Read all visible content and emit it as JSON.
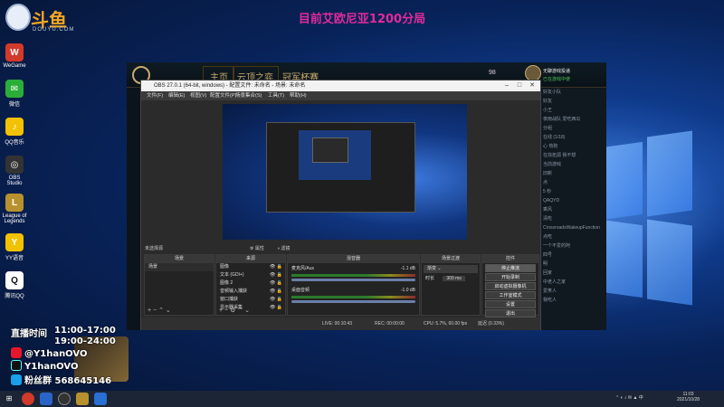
{
  "brand": {
    "name": "斗鱼",
    "domain": "DOUYU.COM"
  },
  "stream_title": "目前艾欧尼亚1200分局",
  "desktop_icons": [
    {
      "label": "WeGame",
      "color": "#d23a2a",
      "glyph": "W"
    },
    {
      "label": "微信",
      "color": "#2aae39",
      "glyph": "✉"
    },
    {
      "label": "QQ音乐",
      "color": "#f2c200",
      "glyph": "♪"
    },
    {
      "label": "OBS Studio",
      "color": "#333333",
      "glyph": "◎"
    },
    {
      "label": "League of Legends",
      "color": "#b8912f",
      "glyph": "L"
    },
    {
      "label": "YY语音",
      "color": "#f2c200",
      "glyph": "Y"
    },
    {
      "label": "腾讯QQ",
      "color": "#ffffff",
      "glyph": "Q"
    }
  ],
  "lol_client": {
    "nav": [
      "主页",
      "云顶之弈",
      "冠军杯赛"
    ],
    "currency": "98",
    "status": "无聊游戏投递",
    "status_sub": "已在游戏中使",
    "right_rows": [
      "好友小队",
      "好友",
      "小王",
      "夜雨战队 爱吃西瓜",
      "分组",
      "在线 (1/18)",
      "心 热狗",
      "在找拓源 我不想",
      "当前游戏",
      "旧新",
      "点",
      "5 秒",
      "QAQYD",
      "乘风",
      "清吃",
      "CrossroadsWakeupFunction",
      "点吃",
      "一个不爱的阿",
      "四号",
      "明",
      "回家",
      "中老人之家",
      "爱笑人",
      "我吃人"
    ]
  },
  "obs": {
    "title": "OBS 27.0.1 (64-bit, windows) - 配置文件: 未命名 - 场景: 未命名",
    "menu": [
      "文件(F)",
      "编辑(E)",
      "视图(V)",
      "配置文件(P)",
      "场景集合(S)",
      "工具(T)",
      "帮助(H)"
    ],
    "no_source": "未选择源",
    "properties": "属性",
    "filters": "滤镜",
    "scenes_header": "场景",
    "scenes": [
      "场景"
    ],
    "sources_header": "来源",
    "sources": [
      "图像",
      "文本 (GDI+)",
      "图像 2",
      "音频输入捕获",
      "窗口捕获",
      "显示器采集"
    ],
    "mixer_header": "混音器",
    "mixer": [
      {
        "name": "麦克风/Aux",
        "db": "-1.1 dB"
      },
      {
        "name": "桌面音频",
        "db": "-1.0 dB"
      }
    ],
    "transitions_header": "场景过渡",
    "transition_type": "渐变",
    "duration_label": "时长",
    "duration_value": "300 ms",
    "controls_header": "控件",
    "controls": [
      "停止推流",
      "开始录制",
      "启动虚拟摄像机",
      "工作室模式",
      "设置",
      "退出"
    ],
    "status": {
      "live": "LIVE: 00:10:43",
      "rec": "REC: 00:00:00",
      "cpu": "CPU: 5.7%, 60.00 fps",
      "dropped": "延迟 (0.33%)"
    }
  },
  "streamer": {
    "schedule_label": "直播时间",
    "schedule_1": "11:00-17:00",
    "schedule_2": "19:00-24:00",
    "weibo": "@Y1hanOVO",
    "douyin": "Y1hanOVO",
    "fans": "粉丝群 568645146"
  },
  "taskbar": {
    "time": "11:03",
    "date": "2021/10/28"
  },
  "colors": {
    "title": "#e12b9b",
    "obs_bg": "#2b2b2b",
    "desktop": "#0f3a8a"
  }
}
